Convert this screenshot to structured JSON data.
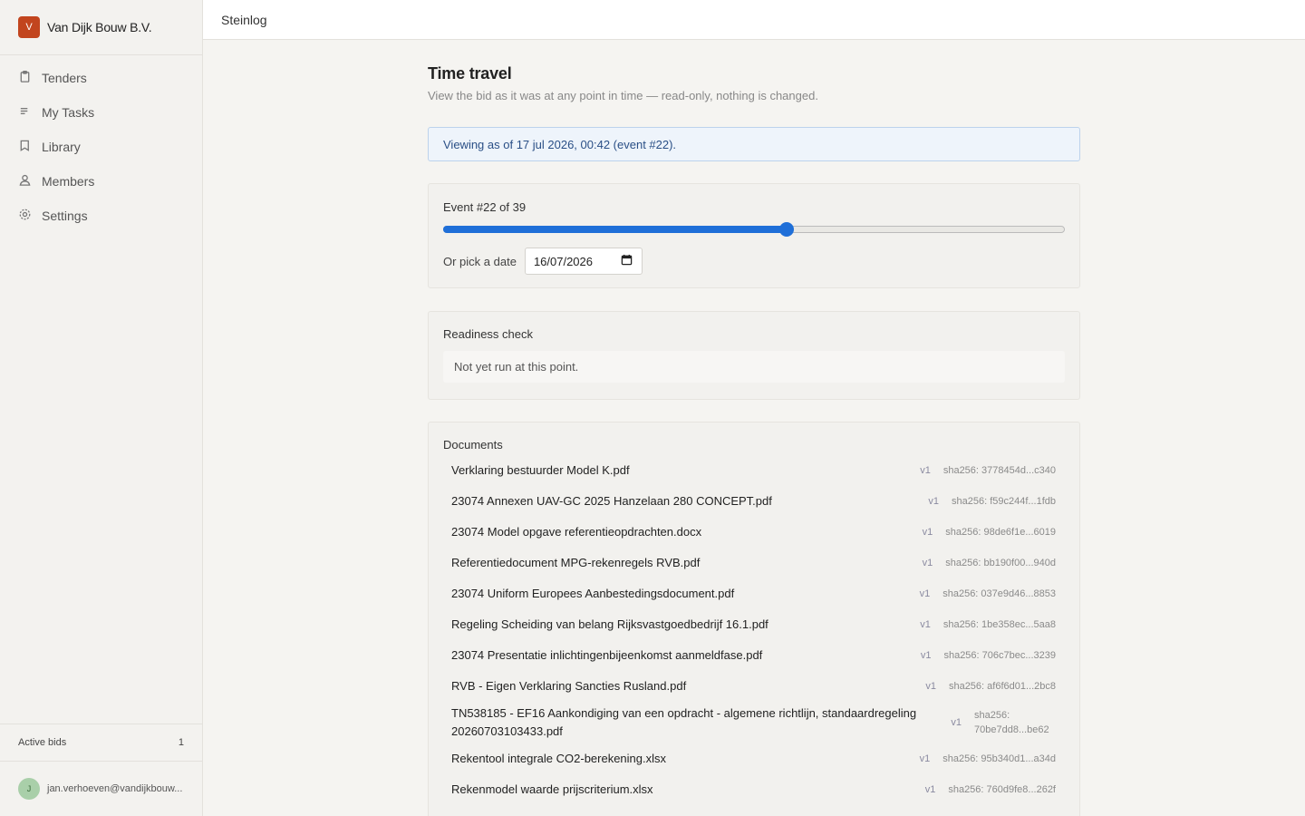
{
  "org": {
    "initial": "V",
    "name": "Van Dijk Bouw B.V."
  },
  "nav": [
    {
      "id": "tenders",
      "label": "Tenders",
      "icon": "clipboard-icon"
    },
    {
      "id": "my-tasks",
      "label": "My Tasks",
      "icon": "list-icon"
    },
    {
      "id": "library",
      "label": "Library",
      "icon": "book-icon"
    },
    {
      "id": "members",
      "label": "Members",
      "icon": "users-icon"
    },
    {
      "id": "settings",
      "label": "Settings",
      "icon": "gear-icon"
    }
  ],
  "active_bids": {
    "label": "Active bids",
    "count": "1"
  },
  "user": {
    "initial": "J",
    "email": "jan.verhoeven@vandijkbouw..."
  },
  "topbar": {
    "title": "Steinlog"
  },
  "page": {
    "title": "Time travel",
    "subtitle": "View the bid as it was at any point in time — read-only, nothing is changed.",
    "info": "Viewing as of 17 jul 2026, 00:42 (event #22)."
  },
  "timeline": {
    "event_label": "Event #22 of 39",
    "current": 22,
    "total": 39,
    "date_label": "Or pick a date",
    "date_value": "16/07/2026"
  },
  "readiness": {
    "title": "Readiness check",
    "status": "Not yet run at this point."
  },
  "documents": {
    "title": "Documents",
    "items": [
      {
        "name": "Verklaring bestuurder Model K.pdf",
        "version": "v1",
        "hash": "sha256: 3778454d...c340"
      },
      {
        "name": "23074 Annexen UAV-GC 2025 Hanzelaan 280 CONCEPT.pdf",
        "version": "v1",
        "hash": "sha256: f59c244f...1fdb"
      },
      {
        "name": "23074 Model opgave referentieopdrachten.docx",
        "version": "v1",
        "hash": "sha256: 98de6f1e...6019"
      },
      {
        "name": "Referentiedocument MPG-rekenregels RVB.pdf",
        "version": "v1",
        "hash": "sha256: bb190f00...940d"
      },
      {
        "name": "23074 Uniform Europees Aanbestedingsdocument.pdf",
        "version": "v1",
        "hash": "sha256: 037e9d46...8853"
      },
      {
        "name": "Regeling Scheiding van belang Rijksvastgoedbedrijf 16.1.pdf",
        "version": "v1",
        "hash": "sha256: 1be358ec...5aa8"
      },
      {
        "name": "23074 Presentatie inlichtingenbijeenkomst aanmeldfase.pdf",
        "version": "v1",
        "hash": "sha256: 706c7bec...3239"
      },
      {
        "name": "RVB - Eigen Verklaring Sancties Rusland.pdf",
        "version": "v1",
        "hash": "sha256: af6f6d01...2bc8"
      },
      {
        "name": "TN538185 - EF16 Aankondiging van een opdracht - algemene richtlijn, standaardregeling 20260703103433.pdf",
        "version": "v1",
        "hash": "sha256: 70be7dd8...be62"
      },
      {
        "name": "Rekentool integrale CO2-berekening.xlsx",
        "version": "v1",
        "hash": "sha256: 95b340d1...a34d"
      },
      {
        "name": "Rekenmodel waarde prijscriterium.xlsx",
        "version": "v1",
        "hash": "sha256: 760d9fe8...262f"
      }
    ]
  }
}
